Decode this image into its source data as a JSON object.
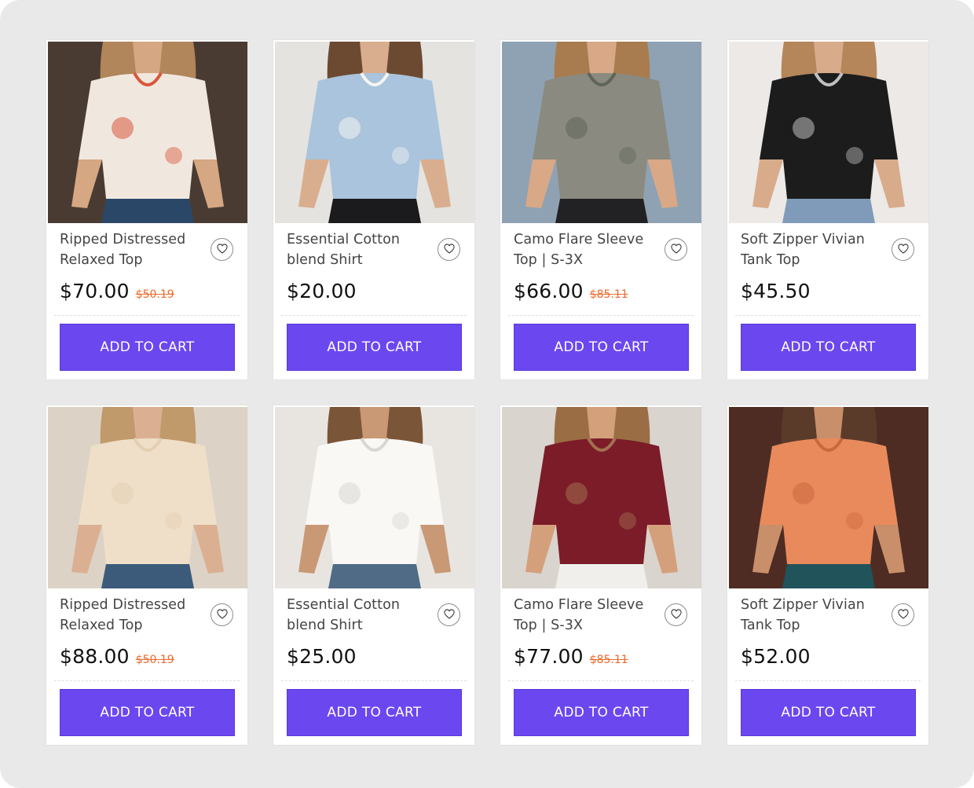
{
  "products": [
    {
      "title": "Ripped Distressed Relaxed Top",
      "price": "$70.00",
      "old_price": "$50.19",
      "cart_label": "ADD TO CART",
      "image": "floral-blouse-photo",
      "palette": {
        "bg": "#4a3b32",
        "garment": "#f0e8df",
        "accent": "#d9573a",
        "skin": "#d5a783",
        "hair": "#b0865a",
        "pants": "#2b4768"
      }
    },
    {
      "title": "Essential Cotton blend Shirt",
      "price": "$20.00",
      "old_price": "",
      "cart_label": "ADD TO CART",
      "image": "denim-shirt-photo",
      "palette": {
        "bg": "#e4e3e0",
        "garment": "#a9c4dc",
        "accent": "#f4f4f2",
        "skin": "#d9ae8f",
        "hair": "#6c4a32",
        "pants": "#1b1b1e"
      }
    },
    {
      "title": "Camo Flare Sleeve Top | S-3X",
      "price": "$66.00",
      "old_price": "$85.11",
      "cart_label": "ADD TO CART",
      "image": "camo-top-photo",
      "palette": {
        "bg": "#8fa2b3",
        "garment": "#8a8a80",
        "accent": "#5f6558",
        "skin": "#d8a887",
        "hair": "#a87c4f",
        "pants": "#222224"
      }
    },
    {
      "title": "Soft Zipper Vivian Tank Top",
      "price": "$45.50",
      "old_price": "",
      "cart_label": "ADD TO CART",
      "image": "black-tank-photo",
      "palette": {
        "bg": "#ece9e6",
        "garment": "#1c1c1c",
        "accent": "#bfbfbf",
        "skin": "#d8ab8b",
        "hair": "#b4865a",
        "pants": "#7f9bb9"
      }
    },
    {
      "title": "Ripped Distressed Relaxed Top",
      "price": "$88.00",
      "old_price": "$50.19",
      "cart_label": "ADD TO CART",
      "image": "cream-blouse-photo",
      "palette": {
        "bg": "#dcd3c6",
        "garment": "#efdfc9",
        "accent": "#e4cfb2",
        "skin": "#dbb092",
        "hair": "#c09a6b",
        "pants": "#3c5b7a"
      }
    },
    {
      "title": "Essential Cotton blend Shirt",
      "price": "$25.00",
      "old_price": "",
      "cart_label": "ADD TO CART",
      "image": "white-cami-photo",
      "palette": {
        "bg": "#e8e5e1",
        "garment": "#f9f8f5",
        "accent": "#dad7d2",
        "skin": "#c99874",
        "hair": "#7a5538",
        "pants": "#506b86"
      }
    },
    {
      "title": "Camo Flare Sleeve Top | S-3X",
      "price": "$77.00",
      "old_price": "$85.11",
      "cart_label": "ADD TO CART",
      "image": "burgundy-tunic-photo",
      "palette": {
        "bg": "#d9d4cd",
        "garment": "#7b1c28",
        "accent": "#a2704f",
        "skin": "#d4a07c",
        "hair": "#9b6d45",
        "pants": "#f1efec"
      }
    },
    {
      "title": "Soft Zipper Vivian Tank Top",
      "price": "$52.00",
      "old_price": "",
      "cart_label": "ADD TO CART",
      "image": "orange-shirt-photo",
      "palette": {
        "bg": "#4e2c23",
        "garment": "#e98a5c",
        "accent": "#c9683e",
        "skin": "#c98f6b",
        "hair": "#5a3b2a",
        "pants": "#21535a"
      }
    }
  ],
  "icons": {
    "wishlist": "heart-outline-icon"
  },
  "colors": {
    "button": "#6b47f0",
    "old_price": "#ee6a2c",
    "background": "#e9e9e9"
  }
}
